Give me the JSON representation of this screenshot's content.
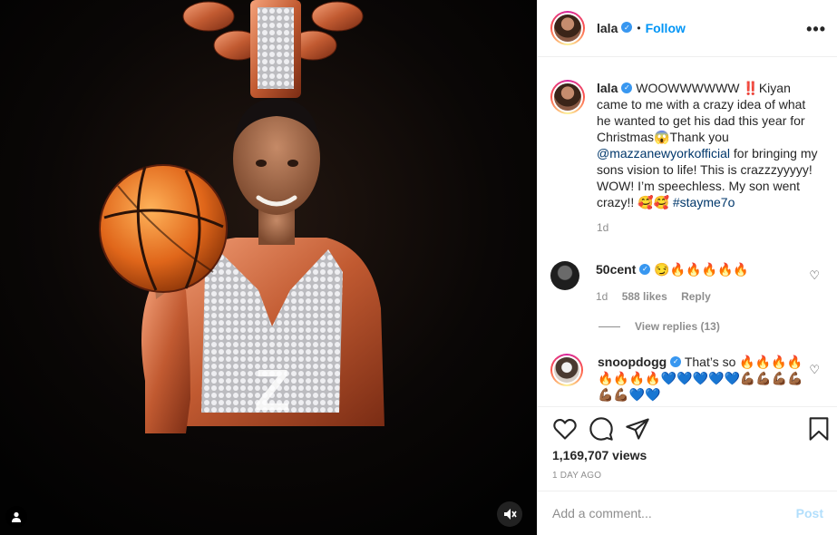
{
  "post": {
    "username": "lala",
    "verified_icon": "verified-badge-icon",
    "follow_separator": "•",
    "follow_label": "Follow",
    "more_label": "•••"
  },
  "caption": {
    "username": "lala",
    "text_1": " WOOWWWWWW ‼️Kiyan came to me with a crazy idea of what he wanted to get his dad this year for Christmas😱Thank you ",
    "mention": "@mazzanewyorkofficial",
    "text_2": " for bringing my sons vision to life! This is crazzzyyyyy! WOW! I’m speechless. My son went crazy!! 🥰🥰 ",
    "hashtag": "#stayme7o",
    "time": "1d"
  },
  "comments": [
    {
      "username": "50cent",
      "text": " 😏🔥🔥🔥🔥🔥",
      "time": "1d",
      "likes": "588 likes",
      "reply_label": "Reply",
      "view_replies": "View replies (13)"
    },
    {
      "username": "snoopdogg",
      "text": " That’s so 🔥🔥🔥🔥🔥🔥🔥🔥💙💙💙💙💙💪🏾💪🏾💪🏾💪🏾💪🏾💪🏾💙💙"
    }
  ],
  "stats": {
    "views": "1,169,707 views",
    "time_ago": "1 DAY AGO"
  },
  "composer": {
    "placeholder": "Add a comment...",
    "post_label": "Post"
  },
  "colors": {
    "accent": "#0095f6",
    "verified": "#3897f0",
    "muted": "#8e8e8e",
    "post_disabled": "#b2dffc"
  },
  "icons": {
    "like": "heart-icon",
    "comment": "comment-icon",
    "share": "paper-plane-icon",
    "save": "bookmark-icon",
    "tag": "user-tag-icon",
    "mute": "speaker-muted-icon",
    "options": "more-options-icon"
  }
}
